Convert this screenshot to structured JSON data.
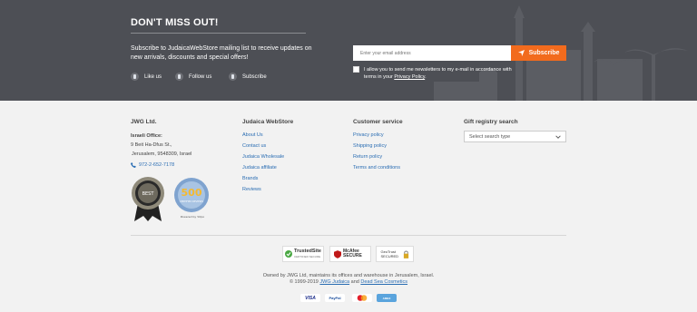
{
  "newsletter": {
    "title": "DON'T MISS OUT!",
    "text": "Subscribe to JudaicaWebStore mailing list to receive updates on new arrivals, discounts and special offers!",
    "email_placeholder": "Enter your email address",
    "subscribe_label": "Subscribe",
    "consent_text": "I allow you to send me newsletters to my e-mail in accordance with terms in your",
    "consent_link": "Privacy Policy",
    "consent_end": ".",
    "social": [
      {
        "label": "Like us",
        "icon": "facebook-icon"
      },
      {
        "label": "Follow us",
        "icon": "twitter-icon"
      },
      {
        "label": "Subscribe",
        "icon": "youtube-icon"
      }
    ]
  },
  "footer": {
    "company": {
      "title": "JWG Ltd.",
      "office_label": "Israeli Office:",
      "address1": "9 Beit Ha-Dfus St.,",
      "address2": "Jerusalem, 9548309, Israel",
      "phone": "972-2-652-7178"
    },
    "badges": {
      "seal_text": "BEST",
      "yotpo_count": "500",
      "yotpo_label": "CERTIFIED REVIEWS",
      "yotpo_powered": "Powered by Yotpo"
    },
    "judaica": {
      "title": "Judaica WebStore",
      "links": [
        "About Us",
        "Contact us",
        "Judaica Wholesale",
        "Judaica affiliate",
        "Brands",
        "Reviews"
      ]
    },
    "customer_service": {
      "title": "Customer service",
      "links": [
        "Privacy policy",
        "Shipping policy",
        "Return policy",
        "Terms and conditions"
      ]
    },
    "gift": {
      "title": "Gift registry search",
      "select_value": "Select search type"
    },
    "trust": {
      "trustedsite": "TrustedSite",
      "trustedsite_sub": "CERTIFIED SECURE",
      "mcafee": "McAfee SECURE",
      "geotrust": "GeoTrust SECURED"
    },
    "owned_line": "Owned by JWG Ltd, maintains its offices and warehouse in Jerusalem, Israel.",
    "copyright_pre": "© 1999-2019",
    "copyright_link1": "JWG Judaica",
    "copyright_and": "and",
    "copyright_link2": "Dead Sea Cosmetics",
    "payments": [
      "VISA",
      "PayPal",
      "MC",
      "AMEX"
    ]
  },
  "colors": {
    "band": "#4d4f55",
    "accent": "#f26b1d",
    "link": "#2a6db3"
  }
}
